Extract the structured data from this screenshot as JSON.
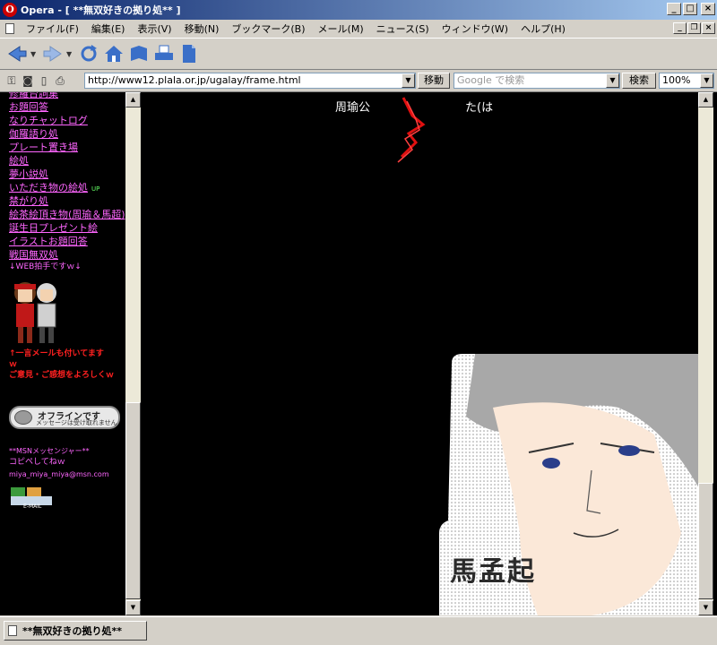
{
  "window": {
    "title": "Opera - [ **無双好きの拠り処** ]",
    "app_glyph": "O"
  },
  "menu": [
    "ファイル(F)",
    "編集(E)",
    "表示(V)",
    "移動(N)",
    "ブックマーク(B)",
    "メール(M)",
    "ニュース(S)",
    "ウィンドウ(W)",
    "ヘルプ(H)"
  ],
  "address": {
    "url": "http://www12.plala.or.jp/ugalay/frame.html",
    "go_label": "移動"
  },
  "search": {
    "placeholder": "Google で検索",
    "button_label": "検索"
  },
  "zoom": "100%",
  "sidebar": {
    "links": [
      "修羅台詞集",
      "お題回答",
      "なりチャットログ",
      "伽羅語り処",
      "プレート置き場",
      "絵処",
      "夢小説処",
      "いただき物の絵処",
      "禁がり処",
      "絵茶絵頂き物(周瑜＆馬超)",
      "誕生日プレゼント絵",
      "イラストお題回答",
      "戦国無双処"
    ],
    "up_badge": "UP",
    "web_clap": "↓WEB拍手ですｗ↓",
    "clap_note_1": "↑一言メールも付いてます",
    "clap_note_2": "ｗ",
    "clap_note_3": "ご意見・ご感想をよろしくｗ",
    "status_main": "オフラインです",
    "status_sub": "メッセージは受け取れません",
    "msn_1": "**MSNメッセンジャー**",
    "msn_2": "コピペしてねｗ",
    "msn_email": "miya_miya_miya@msn.com",
    "email_label": "E-MAIL"
  },
  "main": {
    "text_left": "周瑜公",
    "text_right": "た(は",
    "portrait_name": "馬孟起"
  },
  "status_tab": "**無双好きの拠り処**",
  "colors": {
    "link": "#ff66ff",
    "note_red": "#ff2020",
    "title_start": "#0a246a",
    "title_end": "#a6caf0"
  }
}
